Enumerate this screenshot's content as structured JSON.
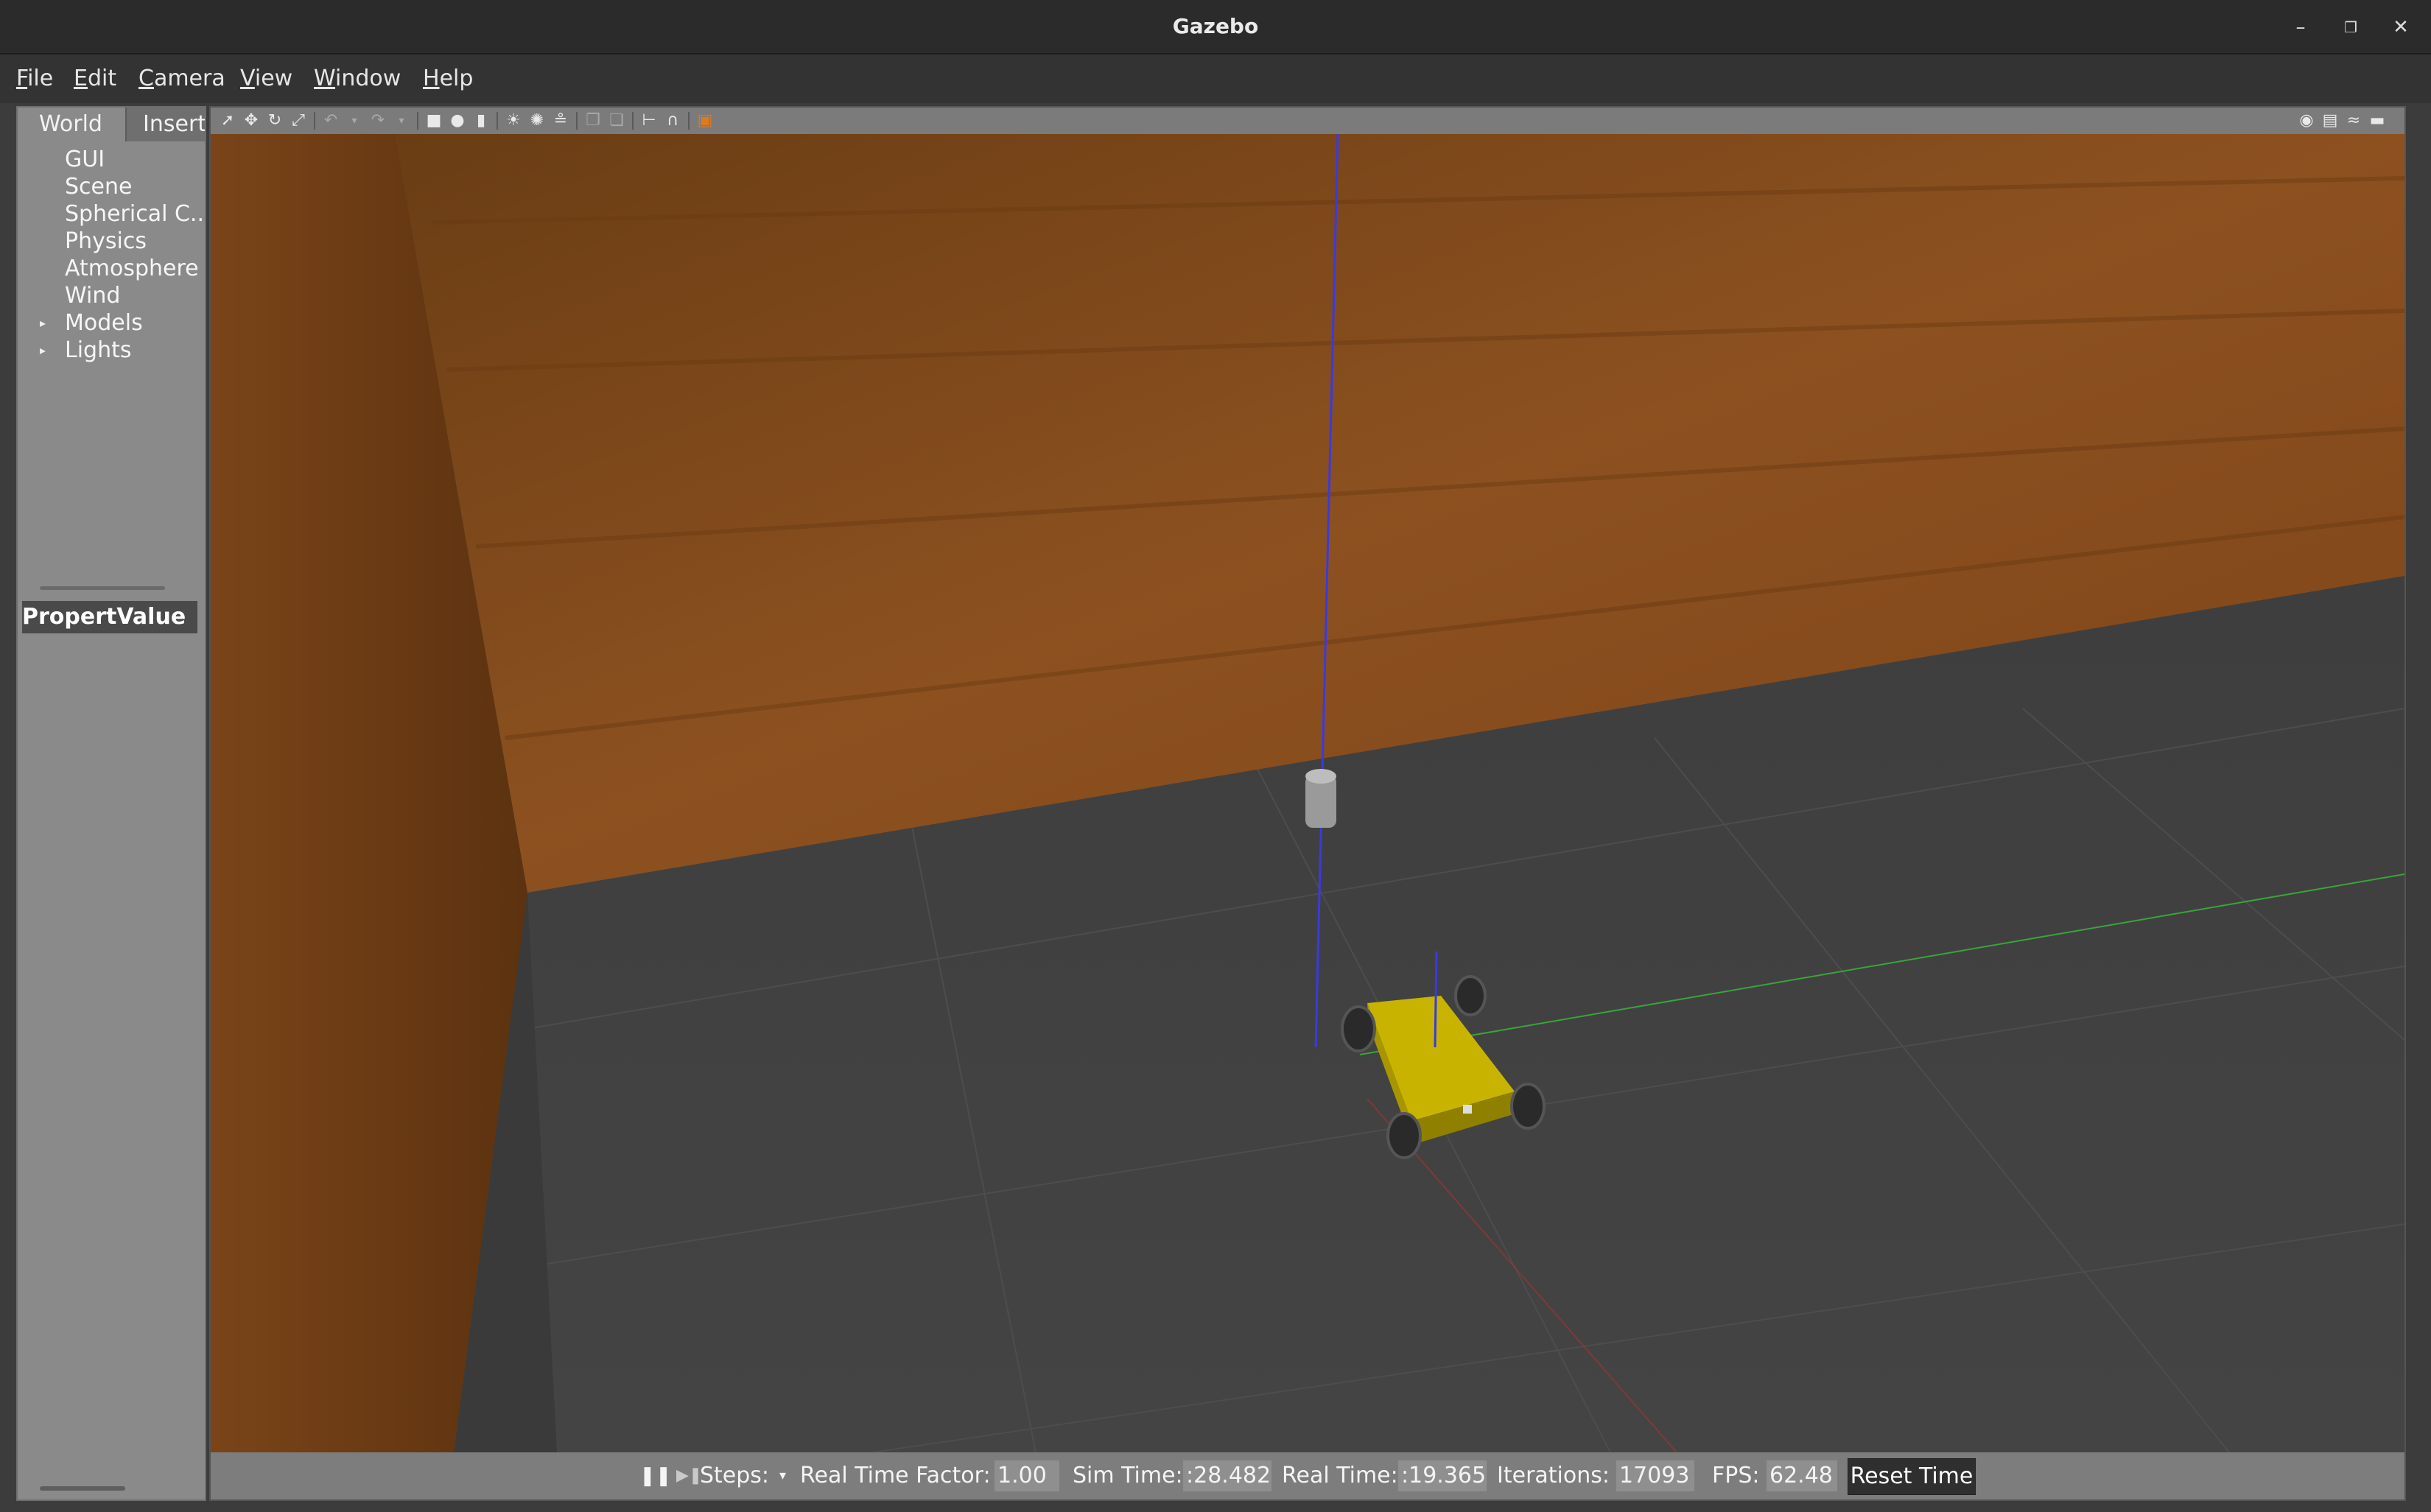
{
  "window": {
    "title": "Gazebo"
  },
  "menu": [
    "File",
    "Edit",
    "Camera",
    "View",
    "Window",
    "Help"
  ],
  "left_panel": {
    "tabs": [
      "World",
      "Insert"
    ],
    "tree": [
      "GUI",
      "Scene",
      "Spherical C..",
      "Physics",
      "Atmosphere",
      "Wind",
      "Models",
      "Lights"
    ],
    "property_header": {
      "property": "Propert",
      "value": "Value"
    }
  },
  "status": {
    "steps_label": "Steps:",
    "real_time_factor_label": "Real Time Factor:",
    "real_time_factor": "1.00",
    "sim_time_label": "Sim Time:",
    "sim_time": ":28.482",
    "real_time_label": "Real Time:",
    "real_time": ":19.365",
    "iterations_label": "Iterations:",
    "iterations": "17093",
    "fps_label": "FPS:",
    "fps": "62.48",
    "reset_label": "Reset Time"
  },
  "colors": {
    "wall": "#8a4c1c",
    "floor": "#3e3e3e",
    "robot": "#c8b400",
    "axis_z": "#3a3ae0",
    "axis_y": "#39a43a",
    "axis_x": "#a83232"
  }
}
